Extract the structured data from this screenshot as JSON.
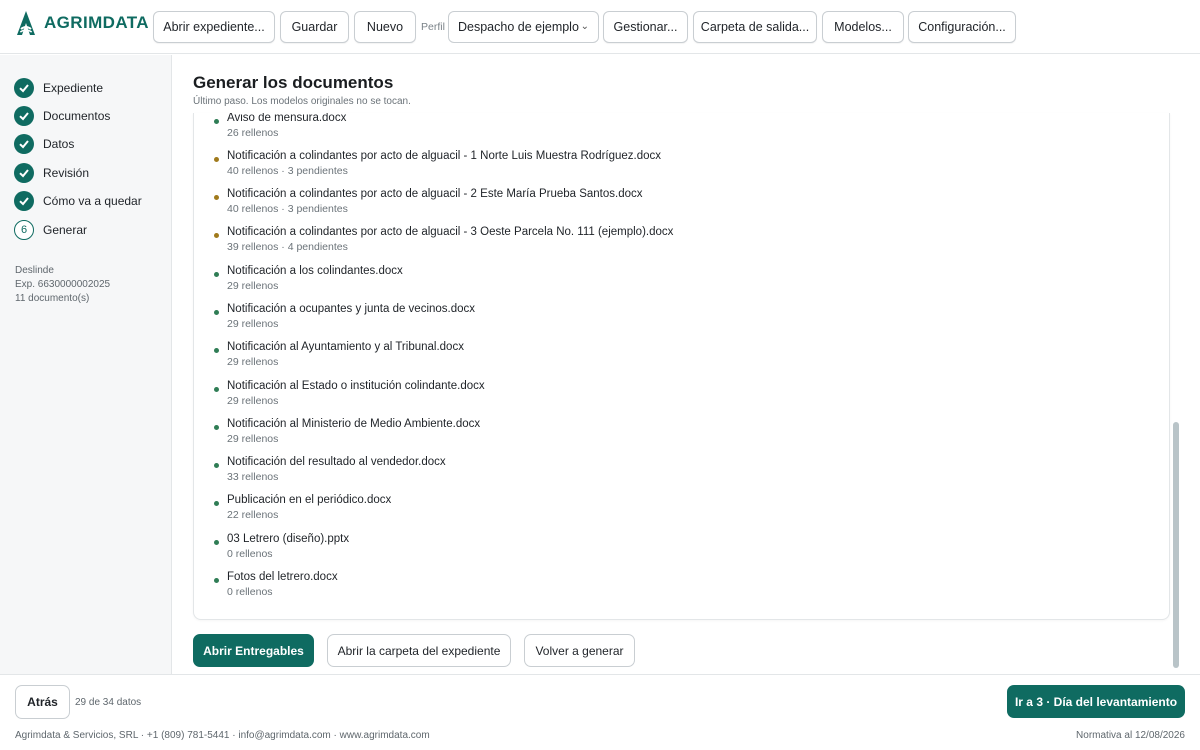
{
  "header": {
    "logo_text": "AGRIMDATA",
    "buttons": [
      "Abrir expediente...",
      "Guardar",
      "Nuevo",
      "Gestionar...",
      "Carpeta de salida...",
      "Modelos...",
      "Configuración..."
    ],
    "perfil_label": "Perfil",
    "perfil_value": "Despacho de ejemplo"
  },
  "sidebar": {
    "steps": [
      {
        "label": "Expediente",
        "state": "done"
      },
      {
        "label": "Documentos",
        "state": "done"
      },
      {
        "label": "Datos",
        "state": "done"
      },
      {
        "label": "Revisión",
        "state": "done"
      },
      {
        "label": "Cómo va a quedar",
        "state": "done"
      },
      {
        "label": "Generar",
        "state": "current",
        "number": "6"
      }
    ],
    "meta": [
      "Deslinde",
      "Exp. 6630000002025",
      "11 documento(s)"
    ]
  },
  "main": {
    "title": "Generar los documentos",
    "subtitle": "Último paso. Los modelos originales no se tocan.",
    "documents": [
      {
        "name": "Aviso de mensura.docx",
        "count": "26 rellenos",
        "status": "ok"
      },
      {
        "name": "Notificación a colindantes por acto de alguacil - 1 Norte Luis Muestra Rodríguez.docx",
        "count": "40 rellenos · 3 pendientes",
        "status": "warn"
      },
      {
        "name": "Notificación a colindantes por acto de alguacil - 2 Este María Prueba Santos.docx",
        "count": "40 rellenos · 3 pendientes",
        "status": "warn"
      },
      {
        "name": "Notificación a colindantes por acto de alguacil - 3 Oeste Parcela No. 111 (ejemplo).docx",
        "count": "39 rellenos · 4 pendientes",
        "status": "warn"
      },
      {
        "name": "Notificación a los colindantes.docx",
        "count": "29 rellenos",
        "status": "ok"
      },
      {
        "name": "Notificación a ocupantes y junta de vecinos.docx",
        "count": "29 rellenos",
        "status": "ok"
      },
      {
        "name": "Notificación al Ayuntamiento y al Tribunal.docx",
        "count": "29 rellenos",
        "status": "ok"
      },
      {
        "name": "Notificación al Estado o institución colindante.docx",
        "count": "29 rellenos",
        "status": "ok"
      },
      {
        "name": "Notificación al Ministerio de Medio Ambiente.docx",
        "count": "29 rellenos",
        "status": "ok"
      },
      {
        "name": "Notificación del resultado al vendedor.docx",
        "count": "33 rellenos",
        "status": "ok"
      },
      {
        "name": "Publicación en el periódico.docx",
        "count": "22 rellenos",
        "status": "ok"
      },
      {
        "name": "03 Letrero (diseño).pptx",
        "count": "0 rellenos",
        "status": "ok"
      },
      {
        "name": "Fotos del letrero.docx",
        "count": "0 rellenos",
        "status": "ok"
      }
    ],
    "actions": {
      "open_deliverables": "Abrir Entregables",
      "open_folder": "Abrir la carpeta del expediente",
      "regenerate": "Volver a generar"
    }
  },
  "footer": {
    "back": "Atrás",
    "data_count": "29 de 34 datos",
    "next": "Ir a 3 · Día del levantamiento",
    "company": "Agrimdata & Servicios, SRL · +1 (809) 781-5441 · info@agrimdata.com · www.agrimdata.com",
    "normativa": "Normativa al 12/08/2026"
  },
  "colors": {
    "accent": "#0f6b61",
    "ok_dot": "#2f7d55",
    "warn_dot": "#a07a1c"
  }
}
